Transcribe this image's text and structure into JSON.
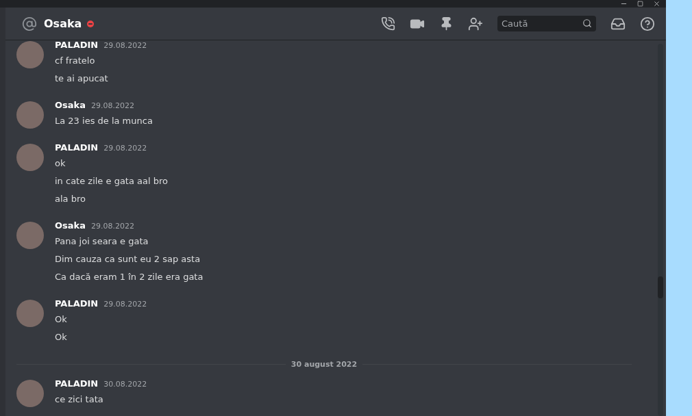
{
  "header": {
    "channel_name": "Osaka",
    "do_not_disturb": true,
    "search": {
      "placeholder": "Caută"
    }
  },
  "feed": [
    {
      "kind": "group",
      "author": "PALADIN",
      "time": "29.08.2022",
      "lines": [
        "cf fratelo",
        "te ai apucat"
      ]
    },
    {
      "kind": "group",
      "author": "Osaka",
      "time": "29.08.2022",
      "lines": [
        "La 23 ies de la munca"
      ]
    },
    {
      "kind": "group",
      "author": "PALADIN",
      "time": "29.08.2022",
      "lines": [
        "ok",
        "in cate zile e gata aal bro",
        "ala bro"
      ]
    },
    {
      "kind": "group",
      "author": "Osaka",
      "time": "29.08.2022",
      "lines": [
        "Pana joi seara e gata",
        "Dim cauza ca sunt eu 2 sap asta",
        "Ca dacă eram 1 în 2 zile era gata"
      ]
    },
    {
      "kind": "group",
      "author": "PALADIN",
      "time": "29.08.2022",
      "lines": [
        "Ok",
        "Ok"
      ]
    },
    {
      "kind": "divider",
      "label": "30 august 2022"
    },
    {
      "kind": "group",
      "author": "PALADIN",
      "time": "30.08.2022",
      "lines": [
        "ce zici tata"
      ]
    }
  ]
}
